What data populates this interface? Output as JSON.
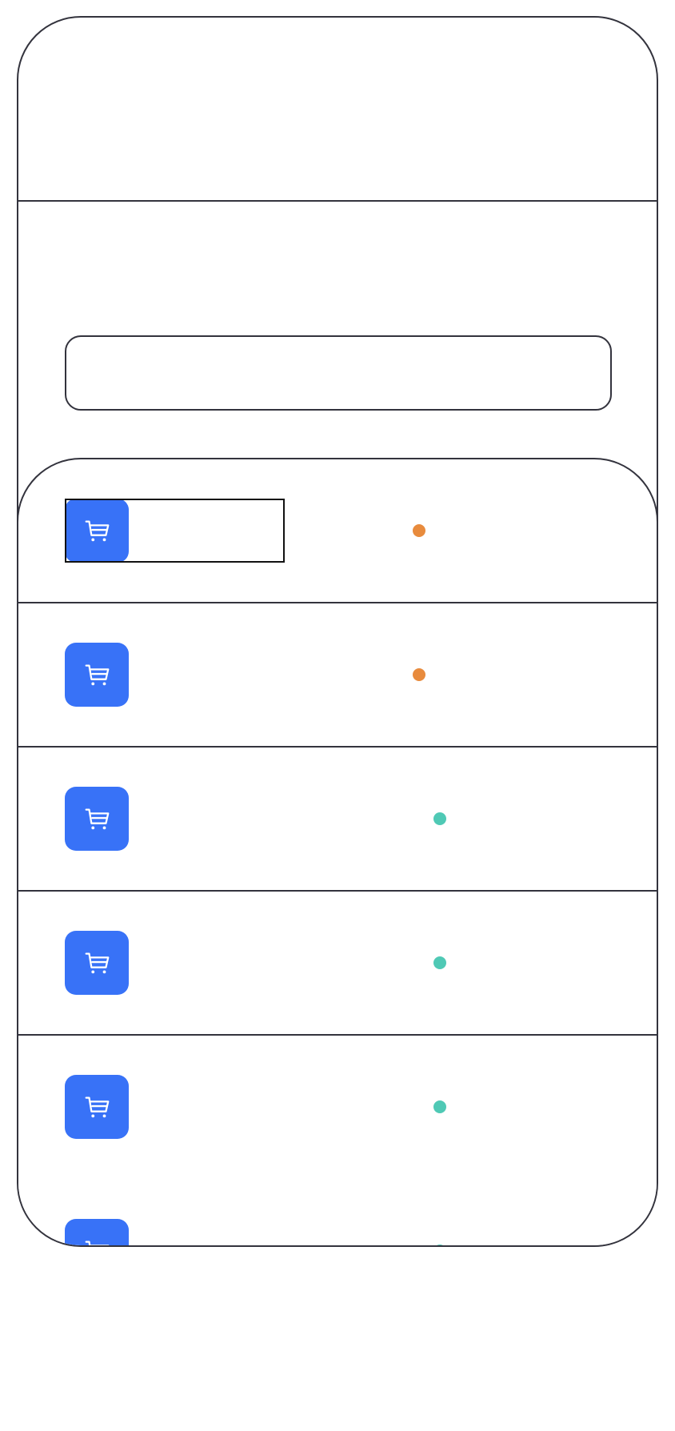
{
  "search": {
    "value": "",
    "placeholder": ""
  },
  "list": {
    "items": [
      {
        "icon": "cart-icon",
        "label": "",
        "status": "",
        "status_color": "#e88b3d"
      },
      {
        "icon": "cart-icon",
        "label": "",
        "status": "",
        "status_color": "#e88b3d"
      },
      {
        "icon": "cart-icon",
        "label": "",
        "status": "",
        "status_color": "#4fc9b5"
      },
      {
        "icon": "cart-icon",
        "label": "",
        "status": "",
        "status_color": "#4fc9b5"
      },
      {
        "icon": "cart-icon",
        "label": "",
        "status": "",
        "status_color": "#4fc9b5"
      },
      {
        "icon": "cart-icon",
        "label": "",
        "status": "",
        "status_color": "#4fc9b5"
      }
    ]
  },
  "colors": {
    "accent": "#3872f7",
    "outline": "#33333d",
    "status_pending": "#e88b3d",
    "status_done": "#4fc9b5"
  }
}
